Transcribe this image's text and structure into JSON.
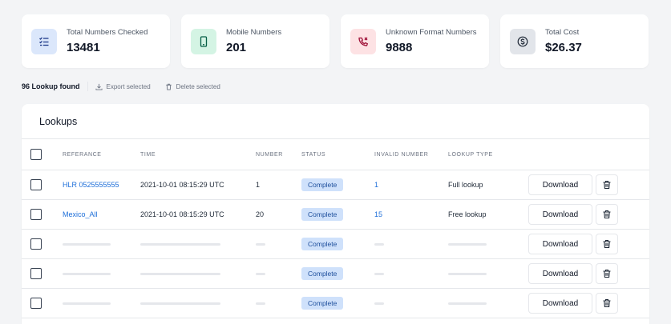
{
  "stats": [
    {
      "label": "Total Numbers Checked",
      "value": "13481",
      "icon": "checklist-icon",
      "bg": "#dbe7fb",
      "fg": "#1e3a8a"
    },
    {
      "label": "Mobile Numbers",
      "value": "201",
      "icon": "mobile-icon",
      "bg": "#d4f4e4",
      "fg": "#065f46"
    },
    {
      "label": "Unknown Format Numbers",
      "value": "9888",
      "icon": "phone-missed-icon",
      "bg": "#fde2e4",
      "fg": "#9f1239"
    },
    {
      "label": "Total Cost",
      "value": "$26.37",
      "icon": "dollar-icon",
      "bg": "#e2e5ea",
      "fg": "#1f2937"
    }
  ],
  "toolbar": {
    "found": "96 Lookup found",
    "export": "Export selected",
    "delete": "Delete selected"
  },
  "panel": {
    "title": "Lookups"
  },
  "table": {
    "headers": {
      "reference": "REFERANCE",
      "time": "TIME",
      "number": "NUMBER",
      "status": "STATUS",
      "invalid": "INVALID NUMBER",
      "type": "LOOKUP TYPE"
    },
    "rows": [
      {
        "reference": "HLR 0525555555",
        "time": "2021-10-01 08:15:29 UTC",
        "number": "1",
        "status": "Complete",
        "invalid": "1",
        "type": "Full lookup",
        "download": "Download"
      },
      {
        "reference": "Mexico_All",
        "time": "2021-10-01 08:15:29 UTC",
        "number": "20",
        "status": "Complete",
        "invalid": "15",
        "type": "Free lookup",
        "download": "Download"
      },
      {
        "status": "Complete",
        "download": "Download"
      },
      {
        "status": "Complete",
        "download": "Download"
      },
      {
        "status": "Complete",
        "download": "Download"
      }
    ]
  }
}
